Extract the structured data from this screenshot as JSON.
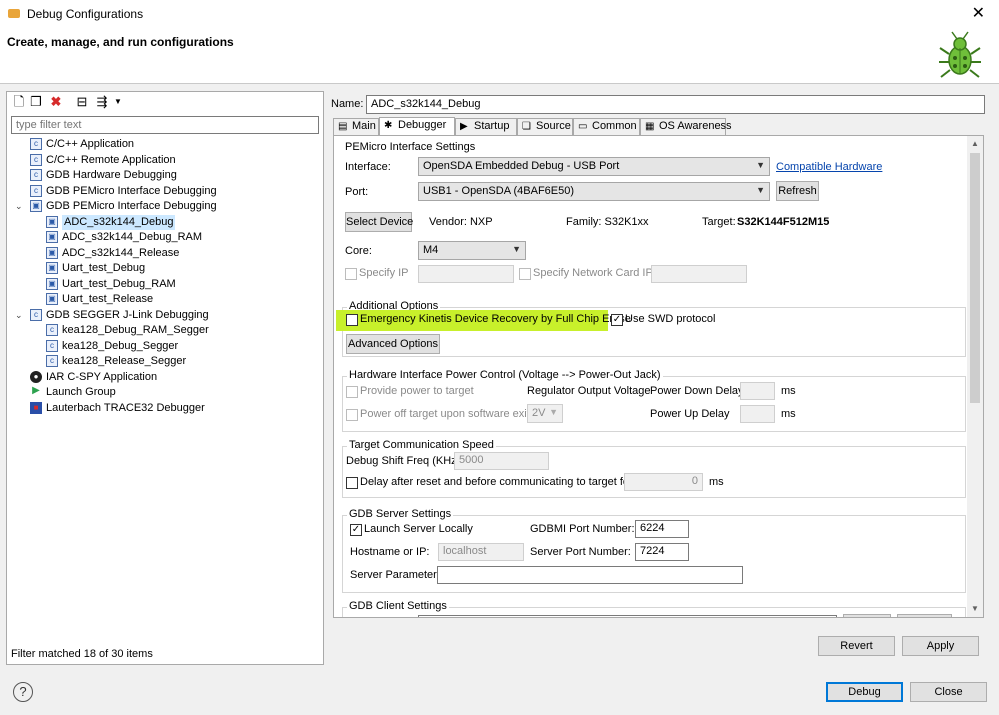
{
  "window": {
    "title": "Debug Configurations",
    "close_glyph": "✕"
  },
  "header": {
    "heading": "Create, manage, and run configurations"
  },
  "left": {
    "filter_placeholder": "type filter text",
    "tree": [
      {
        "label": "C/C++ Application",
        "icon": "c-app-icon",
        "glyph": "c"
      },
      {
        "label": "C/C++ Remote Application",
        "icon": "c-remote-icon",
        "glyph": "c"
      },
      {
        "label": "GDB Hardware Debugging",
        "icon": "c-hw-icon",
        "glyph": "c"
      },
      {
        "label": "GDB PEMicro Interface Debugging",
        "icon": "c-pemicro-icon",
        "glyph": "c"
      },
      {
        "label": "GDB PEMicro Interface Debugging",
        "icon": "pemicro-icon",
        "glyph": "▣",
        "expanded": true
      },
      {
        "label": "ADC_s32k144_Debug",
        "icon": "config-icon",
        "glyph": "▣",
        "selected": true
      },
      {
        "label": "ADC_s32k144_Debug_RAM",
        "icon": "config-icon",
        "glyph": "▣"
      },
      {
        "label": "ADC_s32k144_Release",
        "icon": "config-icon",
        "glyph": "▣"
      },
      {
        "label": "Uart_test_Debug",
        "icon": "config-icon",
        "glyph": "▣"
      },
      {
        "label": "Uart_test_Debug_RAM",
        "icon": "config-icon",
        "glyph": "▣"
      },
      {
        "label": "Uart_test_Release",
        "icon": "config-icon",
        "glyph": "▣"
      },
      {
        "label": "GDB SEGGER J-Link Debugging",
        "icon": "c-segger-icon",
        "glyph": "c",
        "expanded": true
      },
      {
        "label": "kea128_Debug_RAM_Segger",
        "icon": "c-config-icon",
        "glyph": "c"
      },
      {
        "label": "kea128_Debug_Segger",
        "icon": "c-config-icon",
        "glyph": "c"
      },
      {
        "label": "kea128_Release_Segger",
        "icon": "c-config-icon",
        "glyph": "c"
      },
      {
        "label": "IAR C-SPY Application",
        "icon": "iar-icon",
        "glyph": "●"
      },
      {
        "label": "Launch Group",
        "icon": "launch-group-icon",
        "glyph": "▶"
      },
      {
        "label": "Lauterbach TRACE32 Debugger",
        "icon": "trace32-icon",
        "glyph": "■"
      }
    ],
    "status": "Filter matched 18 of 30 items"
  },
  "name": {
    "label": "Name:",
    "value": "ADC_s32k144_Debug"
  },
  "tabs": [
    {
      "label": "Main",
      "icon": "main-tab-icon",
      "glyph": "▤"
    },
    {
      "label": "Debugger",
      "icon": "debugger-tab-icon",
      "glyph": "✱",
      "active": true
    },
    {
      "label": "Startup",
      "icon": "startup-tab-icon",
      "glyph": "▶"
    },
    {
      "label": "Source",
      "icon": "source-tab-icon",
      "glyph": "❏"
    },
    {
      "label": "Common",
      "icon": "common-tab-icon",
      "glyph": "▭"
    },
    {
      "label": "OS Awareness",
      "icon": "os-tab-icon",
      "glyph": "▦"
    }
  ],
  "pemicro": {
    "title": "PEMicro Interface Settings",
    "interface_label": "Interface:",
    "interface_value": "OpenSDA Embedded Debug - USB Port",
    "compatible_link": "Compatible Hardware",
    "port_label": "Port:",
    "port_value": "USB1 - OpenSDA (4BAF6E50)",
    "refresh": "Refresh",
    "select_device": "Select Device",
    "vendor": "Vendor:  NXP",
    "family": "Family:  S32K1xx",
    "target_label": "Target:",
    "target_value": "S32K144F512M15",
    "core_label": "Core:",
    "core_value": "M4",
    "specify_ip": "Specify IP",
    "specify_nic": "Specify Network Card IP"
  },
  "additional": {
    "title": "Additional Options",
    "emergency": "Emergency Kinetis Device Recovery by Full Chip Erase",
    "swd": "Use SWD protocol",
    "swd_check": "✓",
    "advanced": "Advanced Options"
  },
  "power": {
    "title": "Hardware Interface Power Control (Voltage --> Power-Out Jack)",
    "provide": "Provide power to target",
    "regulator": "Regulator Output Voltage",
    "down_delay": "Power Down Delay",
    "ms1": "ms",
    "power_off": "Power off target upon software exit",
    "voltage": "2V",
    "up_delay": "Power Up Delay",
    "ms2": "ms"
  },
  "speed": {
    "title": "Target Communication Speed",
    "shift_label": "Debug Shift Freq (KHz)",
    "shift_value": "5000",
    "delay_label": "Delay after reset and before communicating to target for",
    "delay_value": "0",
    "ms": "ms"
  },
  "gdbserver": {
    "title": "GDB Server Settings",
    "launch_local": "Launch Server Locally",
    "launch_check": "✓",
    "gdbmi_label": "GDBMI Port Number:",
    "gdbmi_value": "6224",
    "host_label": "Hostname or IP:",
    "host_value": "localhost",
    "server_port_label": "Server Port Number:",
    "server_port_value": "7224",
    "params_label": "Server Parameters:",
    "params_value": ""
  },
  "gdbclient": {
    "title": "GDB Client Settings"
  },
  "buttons": {
    "revert": "Revert",
    "apply": "Apply",
    "debug": "Debug",
    "close": "Close",
    "help": "?"
  },
  "colors": {
    "highlight": "#c8f02b",
    "link": "#0645ad",
    "selection": "#cce8ff"
  }
}
